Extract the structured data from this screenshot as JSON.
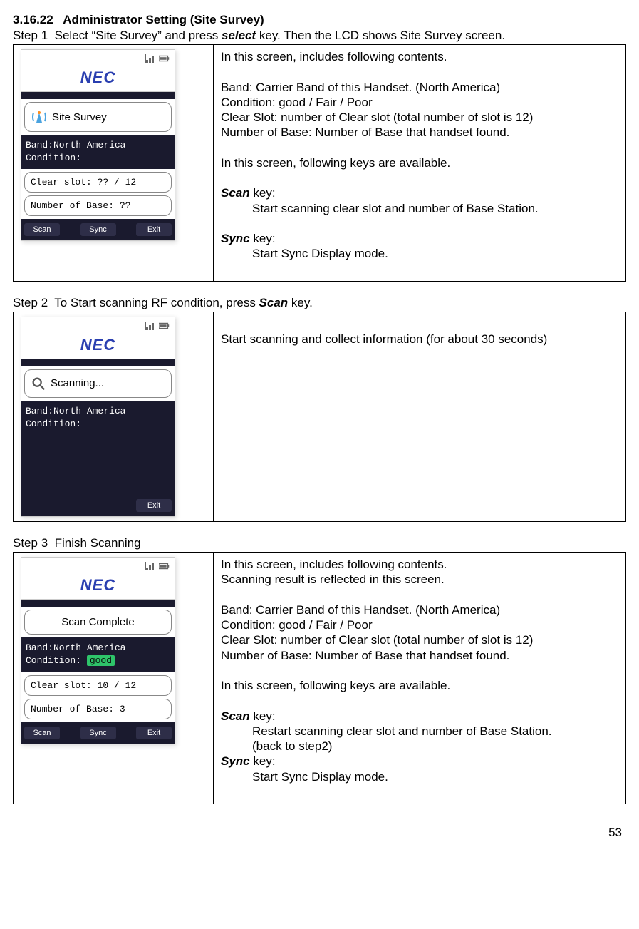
{
  "section": {
    "number": "3.16.22",
    "title": "Administrator Setting (Site Survey)"
  },
  "steps": {
    "s1": {
      "label": "Step 1",
      "text_a": "Select “Site Survey” and press ",
      "select": "select",
      "text_b": " key. Then the LCD shows Site Survey screen."
    },
    "s2": {
      "label": "Step 2",
      "text_a": "To Start scanning RF condition, press ",
      "scan": "Scan",
      "text_b": " key."
    },
    "s3": {
      "label": "Step 3",
      "text": "Finish Scanning"
    }
  },
  "desc1": {
    "l1": "In this screen, includes following contents.",
    "l2": "Band: Carrier Band of this Handset. (North America)",
    "l3": "Condition: good / Fair / Poor",
    "l4": "Clear Slot: number of Clear slot (total number of slot is 12)",
    "l5": "Number of Base: Number of Base that handset found.",
    "l6": "In this screen, following keys are available.",
    "scan_label": "Scan",
    "scan_suffix": " key:",
    "scan_text": "Start scanning clear slot and number of Base Station.",
    "sync_label": "Sync",
    "sync_suffix": " key:",
    "sync_text": "Start Sync Display mode."
  },
  "desc2": {
    "l1": "Start scanning and collect information (for about 30 seconds)"
  },
  "desc3": {
    "l1": "In this screen, includes following contents.",
    "l1b": "Scanning result is reflected in this screen.",
    "l2": "Band: Carrier Band of this Handset. (North America)",
    "l3": "Condition: good / Fair / Poor",
    "l4": "Clear Slot: number of Clear slot (total number of slot is 12)",
    "l5": "Number of Base: Number of Base that handset found.",
    "l6": "In this screen, following keys are available.",
    "scan_label": "Scan",
    "scan_suffix": " key:",
    "scan_text1": "Restart scanning clear slot and number of Base Station.",
    "scan_text2": "(back to step2)",
    "sync_label": "Sync",
    "sync_suffix": " key:",
    "sync_text": "Start Sync Display mode."
  },
  "phone_common": {
    "nec": "NEC",
    "band_line": "Band:North America",
    "cond_line": "Condition:",
    "softkeys": {
      "scan": "Scan",
      "sync": "Sync",
      "exit": "Exit"
    }
  },
  "phone1": {
    "title": "Site Survey",
    "clear_slot": "Clear slot:  ?? / 12",
    "num_base": "Number of Base:  ??"
  },
  "phone2": {
    "title": "Scanning..."
  },
  "phone3": {
    "title": "Scan Complete",
    "cond_value": "good",
    "clear_slot": "Clear slot:  10 / 12",
    "num_base": "Number of Base:  3"
  },
  "page_number": "53"
}
